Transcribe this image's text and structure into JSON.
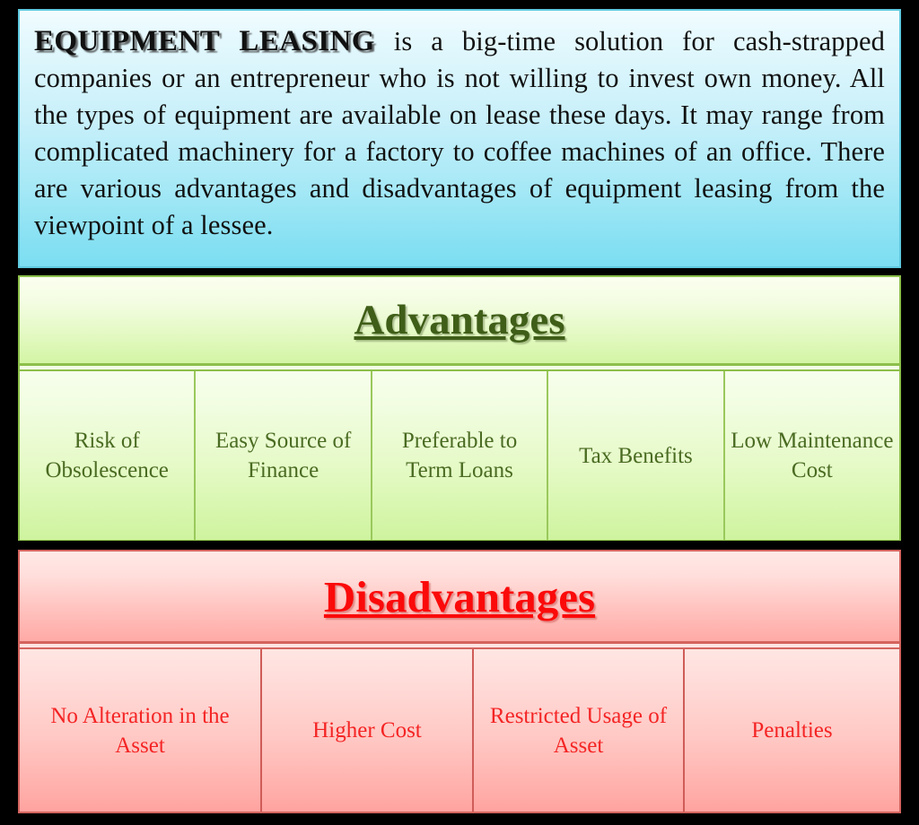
{
  "intro": {
    "lead": "EQUIPMENT LEASING",
    "body": " is a big-time solution for cash-strapped companies or an entrepreneur who is not willing to invest own money. All the types of equipment are available on lease these days. It may range from complicated machinery for a factory to coffee machines of an office. There are various advantages and disadvantages of equipment leasing from the viewpoint of a lessee.",
    "colors": {
      "panel_top": "#f2fcff",
      "panel_bottom": "#7ddff2",
      "border": "#5fc9df",
      "text": "#111111"
    }
  },
  "advantages": {
    "title": "Advantages",
    "colors": {
      "title_text": "#3f5e18",
      "cell_text": "#4a6b22",
      "border": "#8cbf4a",
      "divider": "#9ac85c",
      "cell_top": "#f7ffec",
      "cell_bottom": "#cef39f"
    },
    "items": [
      {
        "label": "Risk of Obsolescence"
      },
      {
        "label": "Easy Source of Finance"
      },
      {
        "label": "Preferable to Term Loans"
      },
      {
        "label": "Tax Benefits"
      },
      {
        "label": "Low Maintenance Cost"
      }
    ]
  },
  "disadvantages": {
    "title": "Disadvantages",
    "colors": {
      "title_text": "#fb0a0a",
      "cell_text": "#f42424",
      "border": "#d4645f",
      "divider": "#cf5c58",
      "cell_top": "#ffe6e3",
      "cell_bottom": "#ffa39f"
    },
    "items": [
      {
        "label": "No Alteration in the Asset"
      },
      {
        "label": "Higher Cost"
      },
      {
        "label": "Restricted Usage of Asset"
      },
      {
        "label": "Penalties"
      }
    ]
  },
  "page": {
    "background": "#000000"
  }
}
